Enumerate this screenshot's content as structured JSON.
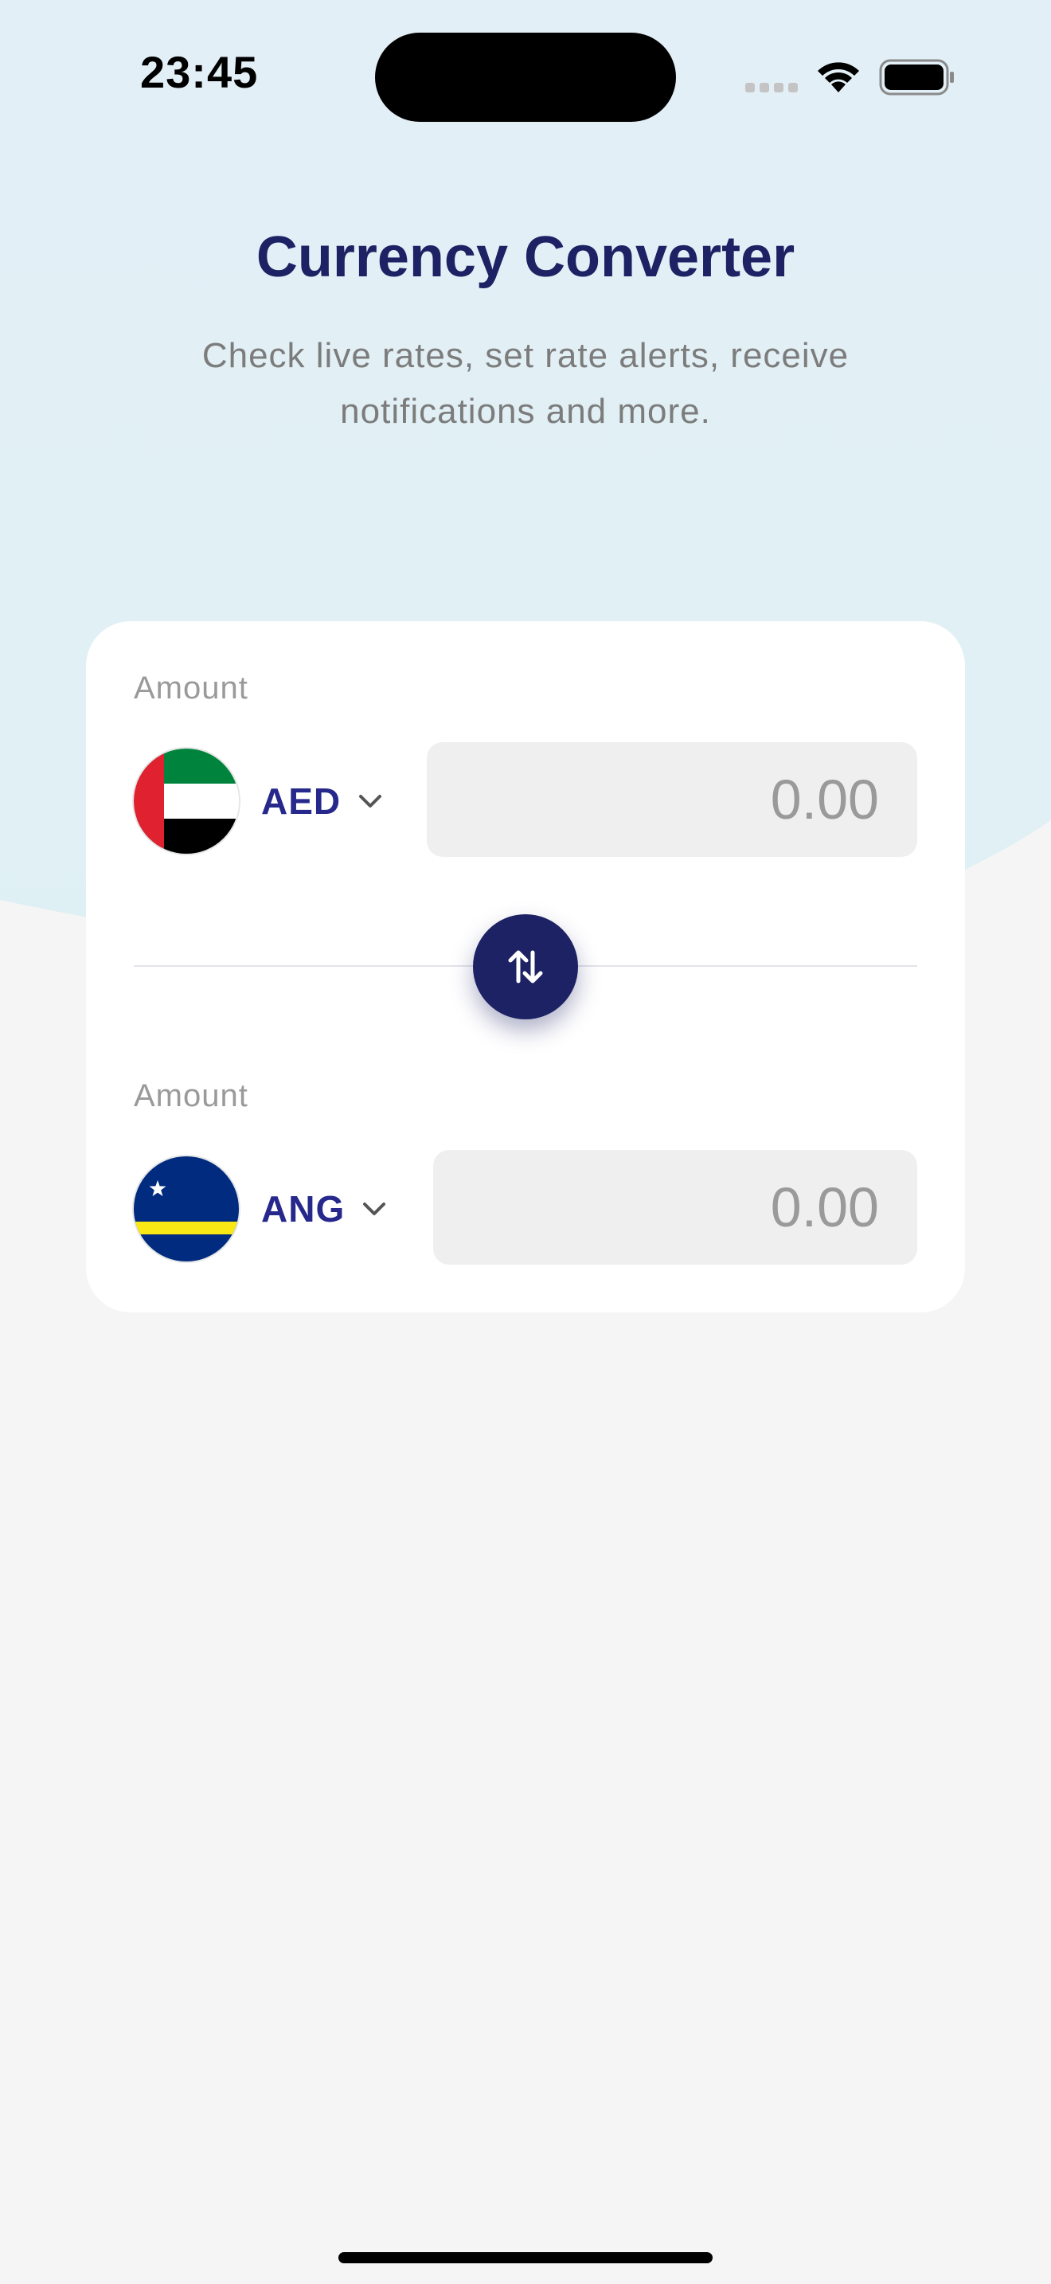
{
  "status_bar": {
    "time": "23:45"
  },
  "header": {
    "title": "Currency Converter",
    "subtitle": "Check live rates, set rate alerts, receive notifications and more."
  },
  "converter": {
    "from": {
      "label": "Amount",
      "currency": "AED",
      "flag_icon": "uae-flag-icon",
      "amount_placeholder": "0.00"
    },
    "to": {
      "label": "Amount",
      "currency": "ANG",
      "flag_icon": "curacao-flag-icon",
      "amount_placeholder": "0.00"
    },
    "swap_icon": "swap-arrows-icon"
  },
  "colors": {
    "primary": "#1c2263",
    "currency_text": "#26288c",
    "background_top": "#e1f0f6",
    "background_bottom": "#f5f5f5",
    "card": "#ffffff",
    "field": "#efefef"
  }
}
